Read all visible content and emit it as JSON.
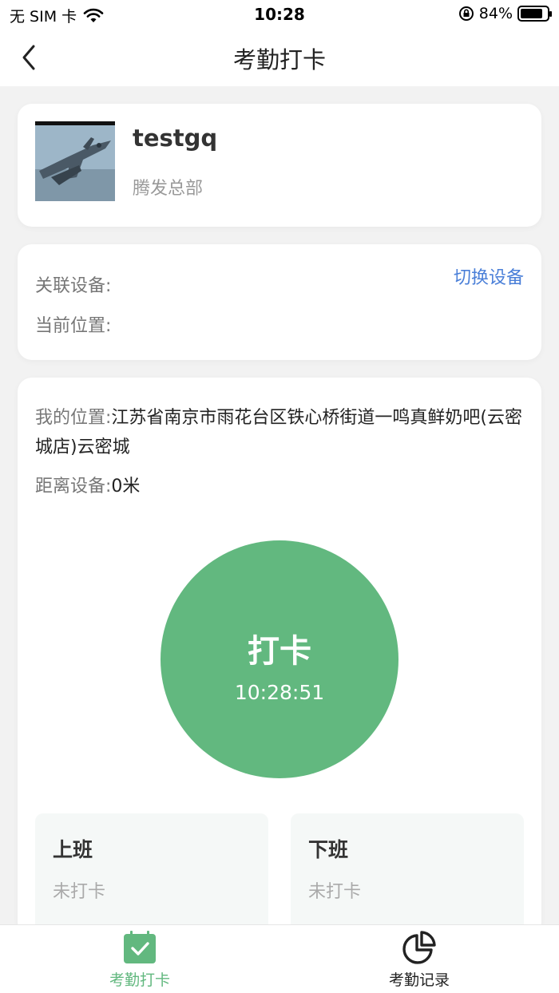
{
  "status_bar": {
    "carrier": "无 SIM 卡",
    "time": "10:28",
    "battery": "84%",
    "battery_level": 0.84
  },
  "nav": {
    "title": "考勤打卡"
  },
  "profile": {
    "name": "testgq",
    "department": "腾发总部"
  },
  "device": {
    "linked_label": "关联设备:",
    "location_label": "当前位置:",
    "switch_label": "切换设备"
  },
  "location": {
    "my_location_label": "我的位置:",
    "my_location_value": "江苏省南京市雨花台区铁心桥街道一鸣真鲜奶吧(云密城店)云密城",
    "distance_label": "距离设备:",
    "distance_value": "0米"
  },
  "punch": {
    "label": "打卡",
    "time": "10:28:51"
  },
  "shifts": [
    {
      "title": "上班",
      "status": "未打卡"
    },
    {
      "title": "下班",
      "status": "未打卡"
    }
  ],
  "tabs": [
    {
      "label": "考勤打卡",
      "icon": "calendar-check-icon",
      "active": true
    },
    {
      "label": "考勤记录",
      "icon": "pie-chart-icon",
      "active": false
    }
  ],
  "colors": {
    "accent_green": "#62b87f",
    "link_blue": "#4a7fd8"
  }
}
